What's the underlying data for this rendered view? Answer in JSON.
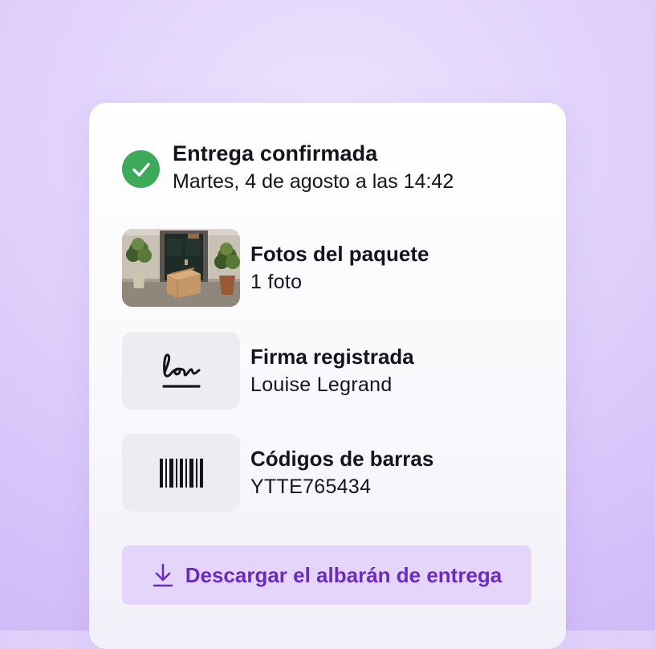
{
  "delivery": {
    "status_title": "Entrega confirmada",
    "status_datetime": "Martes, 4 de agosto a las 14:42",
    "status_icon": "check-circle-icon",
    "status_color": "#3daa5a"
  },
  "items": [
    {
      "title": "Fotos del paquete",
      "subtitle": "1 foto",
      "thumb": "package-photo"
    },
    {
      "title": "Firma registrada",
      "subtitle": "Louise Legrand",
      "icon": "signature-icon"
    },
    {
      "title": "Códigos de barras",
      "subtitle": "YTTE765434",
      "icon": "barcode-icon"
    }
  ],
  "download": {
    "label": "Descargar el albarán de entrega",
    "icon": "download-icon",
    "background": "#e5d5fa",
    "color": "#6a2bbf"
  }
}
